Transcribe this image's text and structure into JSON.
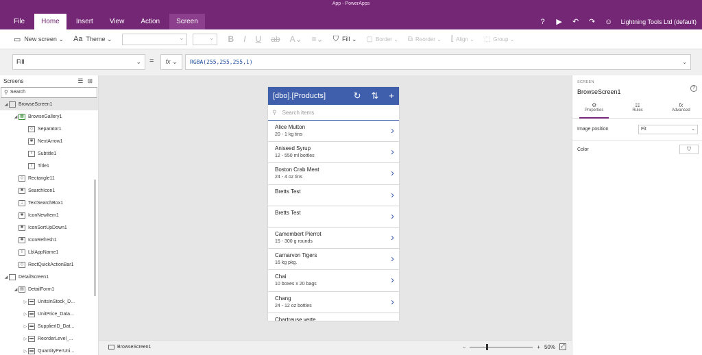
{
  "window": {
    "title": "App - PowerApps"
  },
  "ribbon": {
    "tabs": [
      {
        "label": "File"
      },
      {
        "label": "Home"
      },
      {
        "label": "Insert"
      },
      {
        "label": "View"
      },
      {
        "label": "Action"
      },
      {
        "label": "Screen"
      }
    ],
    "active_tab": "Home",
    "account": "Lightning Tools Ltd (default)"
  },
  "toolbar": {
    "new_screen": "New screen",
    "theme": "Theme",
    "fill": "Fill",
    "border": "Border",
    "reorder": "Reorder",
    "align": "Align",
    "group": "Group"
  },
  "formula": {
    "property": "Fill",
    "fx": "fx",
    "expression": "RGBA(255,255,255,1)"
  },
  "left_panel": {
    "title": "Screens",
    "search_placeholder": "Search",
    "tree": [
      {
        "label": "BrowseScreen1",
        "level": 0,
        "icon": "screen-icon",
        "expanded": true,
        "selected": true
      },
      {
        "label": "BrowseGallery1",
        "level": 1,
        "icon": "gallery-icon",
        "expanded": true
      },
      {
        "label": "Separator1",
        "level": 2,
        "icon": "shape-icon"
      },
      {
        "label": "NextArrow1",
        "level": 2,
        "icon": "icon-icon"
      },
      {
        "label": "Subtitle1",
        "level": 2,
        "icon": "label-icon"
      },
      {
        "label": "Title1",
        "level": 2,
        "icon": "label-icon"
      },
      {
        "label": "Rectangle11",
        "level": 1,
        "icon": "shape-icon"
      },
      {
        "label": "SearchIcon1",
        "level": 1,
        "icon": "icon-icon"
      },
      {
        "label": "TextSearchBox1",
        "level": 1,
        "icon": "textbox-icon"
      },
      {
        "label": "IconNewItem1",
        "level": 1,
        "icon": "icon-icon"
      },
      {
        "label": "IconSortUpDown1",
        "level": 1,
        "icon": "icon-icon"
      },
      {
        "label": "IconRefresh1",
        "level": 1,
        "icon": "icon-icon"
      },
      {
        "label": "LblAppName1",
        "level": 1,
        "icon": "label-icon"
      },
      {
        "label": "RectQuickActionBar1",
        "level": 1,
        "icon": "shape-icon"
      },
      {
        "label": "DetailScreen1",
        "level": 0,
        "icon": "screen-icon",
        "expanded": true
      },
      {
        "label": "DetailForm1",
        "level": 1,
        "icon": "form-icon",
        "expanded": true
      },
      {
        "label": "UnitsInStock_D...",
        "level": 2,
        "icon": "card-icon",
        "collapsed": true
      },
      {
        "label": "UnitPrice_Data...",
        "level": 2,
        "icon": "card-icon",
        "collapsed": true
      },
      {
        "label": "SupplierID_Dat...",
        "level": 2,
        "icon": "card-icon",
        "collapsed": true
      },
      {
        "label": "ReorderLevel_...",
        "level": 2,
        "icon": "card-icon",
        "collapsed": true
      },
      {
        "label": "QuantityPerUni...",
        "level": 2,
        "icon": "card-icon",
        "collapsed": true
      }
    ]
  },
  "app": {
    "title": "[dbo].[Products]",
    "search_placeholder": "Search items",
    "items": [
      {
        "title": "Alice Mutton",
        "subtitle": "20 - 1 kg tins"
      },
      {
        "title": "Aniseed Syrup",
        "subtitle": "12 - 550 ml bottles"
      },
      {
        "title": "Boston Crab Meat",
        "subtitle": "24 - 4 oz tins"
      },
      {
        "title": "Bretts Test",
        "subtitle": ""
      },
      {
        "title": "Bretts Test",
        "subtitle": ""
      },
      {
        "title": "Camembert Pierrot",
        "subtitle": "15 - 300 g rounds"
      },
      {
        "title": "Carnarvon Tigers",
        "subtitle": "16 kg pkg."
      },
      {
        "title": "Chai",
        "subtitle": "10 boxes x 20 bags"
      },
      {
        "title": "Chang",
        "subtitle": "24 - 12 oz bottles"
      },
      {
        "title": "Chartreuse verte",
        "subtitle": ""
      }
    ]
  },
  "status": {
    "screen": "BrowseScreen1",
    "zoom_minus": "−",
    "zoom_plus": "+",
    "zoom": "50%"
  },
  "right_panel": {
    "kind": "SCREEN",
    "name": "BrowseScreen1",
    "tabs": [
      {
        "label": "Properties",
        "icon": "sliders-icon"
      },
      {
        "label": "Rules",
        "icon": "rules-icon"
      },
      {
        "label": "Advanced",
        "icon": "fx-icon"
      }
    ],
    "image_position_label": "Image position",
    "image_position_value": "Fit",
    "color_label": "Color"
  },
  "colors": {
    "ribbon": "#742774",
    "app_header": "#3f5fad"
  }
}
